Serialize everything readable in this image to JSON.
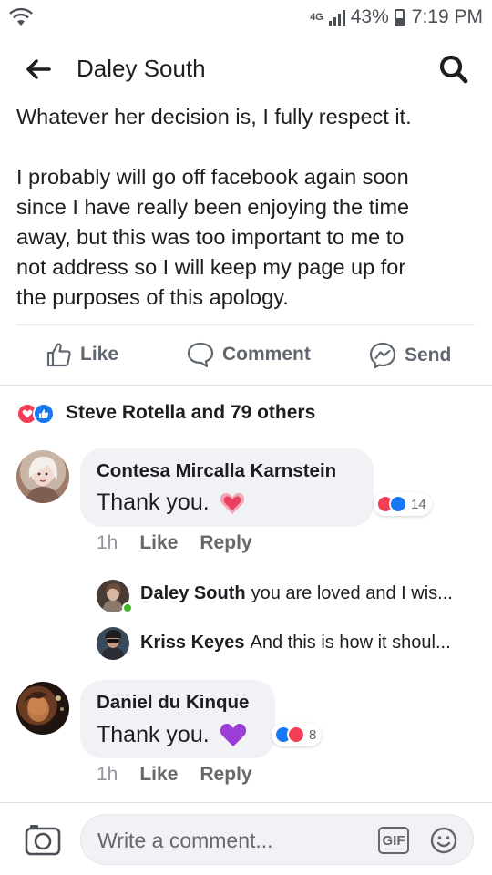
{
  "status_bar": {
    "network": "4G",
    "battery": "43%",
    "time": "7:19 PM"
  },
  "header": {
    "title": "Daley South",
    "back_icon": "arrow-left-icon",
    "search_icon": "search-icon"
  },
  "post": {
    "lines": [
      "Whatever her decision is, I fully respect it.",
      "",
      "I probably will go off facebook again soon",
      "since I have really been enjoying the time",
      "away, but this was too important to me to",
      "not address so I will keep my page up for",
      "the purposes of this apology."
    ]
  },
  "actions": {
    "like": "Like",
    "comment": "Comment",
    "send": "Send"
  },
  "reactions": {
    "summary": "Steve Rotella and 79 others",
    "types": [
      "heart",
      "like"
    ]
  },
  "comments": [
    {
      "author": "Contesa Mircalla Karnstein",
      "text": "Thank you.",
      "emoji": "pink-heart",
      "time": "1h",
      "like": "Like",
      "reply": "Reply",
      "reaction_count": "14",
      "reaction_types": [
        "heart",
        "like"
      ],
      "replies": [
        {
          "author": "Daley South",
          "text": "you are loved and I wis...",
          "online": true
        },
        {
          "author": "Kriss Keyes",
          "text": "And this is how it shoul...",
          "online": false
        }
      ]
    },
    {
      "author": "Daniel du Kinque",
      "text": "Thank you.",
      "emoji": "purple-heart",
      "time": "1h",
      "like": "Like",
      "reply": "Reply",
      "reaction_count": "8",
      "reaction_types": [
        "like",
        "heart"
      ],
      "replies": []
    }
  ],
  "composer": {
    "placeholder": "Write a comment...",
    "gif_label": "GIF"
  },
  "colors": {
    "like_blue": "#1877f2",
    "love_red": "#f33e58",
    "bubble_gray": "#f0f2f5",
    "online_green": "#42b72a",
    "purple_heart": "#9b3ed8"
  }
}
